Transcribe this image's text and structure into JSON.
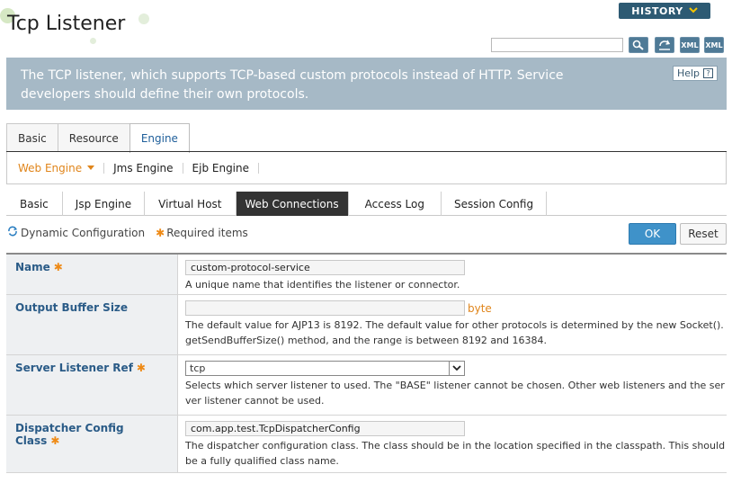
{
  "header": {
    "title": "Tcp Listener",
    "history_label": "HISTORY",
    "search_value": "",
    "tool_xml1": "XML",
    "tool_xml2": "XML"
  },
  "banner": {
    "text": "The TCP listener, which supports TCP-based custom protocols instead of HTTP. Service developers should define their own protocols.",
    "help_label": "Help",
    "help_icon": "?"
  },
  "main_tabs": [
    {
      "label": "Basic",
      "active": false
    },
    {
      "label": "Resource",
      "active": false
    },
    {
      "label": "Engine",
      "active": true
    }
  ],
  "sub_nav": [
    {
      "label": "Web Engine",
      "active": true
    },
    {
      "label": "Jms Engine",
      "active": false
    },
    {
      "label": "Ejb Engine",
      "active": false
    }
  ],
  "engine_tabs": [
    {
      "label": "Basic",
      "active": false
    },
    {
      "label": "Jsp Engine",
      "active": false
    },
    {
      "label": "Virtual Host",
      "active": false
    },
    {
      "label": "Web Connections",
      "active": true
    },
    {
      "label": "Access Log",
      "active": false
    },
    {
      "label": "Session Config",
      "active": false
    }
  ],
  "legend": {
    "dynamic": "Dynamic Configuration",
    "required": "Required items"
  },
  "actions": {
    "ok": "OK",
    "reset": "Reset"
  },
  "form": {
    "name": {
      "label": "Name",
      "value": "custom-protocol-service",
      "desc": "A unique name that identifies the listener or connector."
    },
    "buffer": {
      "label": "Output Buffer Size",
      "value": "",
      "unit": "byte",
      "desc": "The default value for AJP13 is 8192. The default value for other protocols is determined by the new Socket().getSendBufferSize() method, and the range is between 8192 and 16384."
    },
    "server_ref": {
      "label": "Server Listener Ref",
      "value": "tcp",
      "desc": "Selects which server listener to used. The \"BASE\" listener cannot be chosen. Other web listeners and the server listener cannot be used."
    },
    "dispatcher": {
      "label": "Dispatcher Config Class",
      "value": "com.app.test.TcpDispatcherConfig",
      "desc": "The dispatcher configuration class. The class should be in the location specified in the classpath. This should be a fully qualified class name."
    }
  },
  "colors": {
    "accent_orange": "#e0851b",
    "link_blue": "#2a5b87",
    "banner_bg": "#a6b9c6",
    "ok_blue": "#3f92c9"
  }
}
